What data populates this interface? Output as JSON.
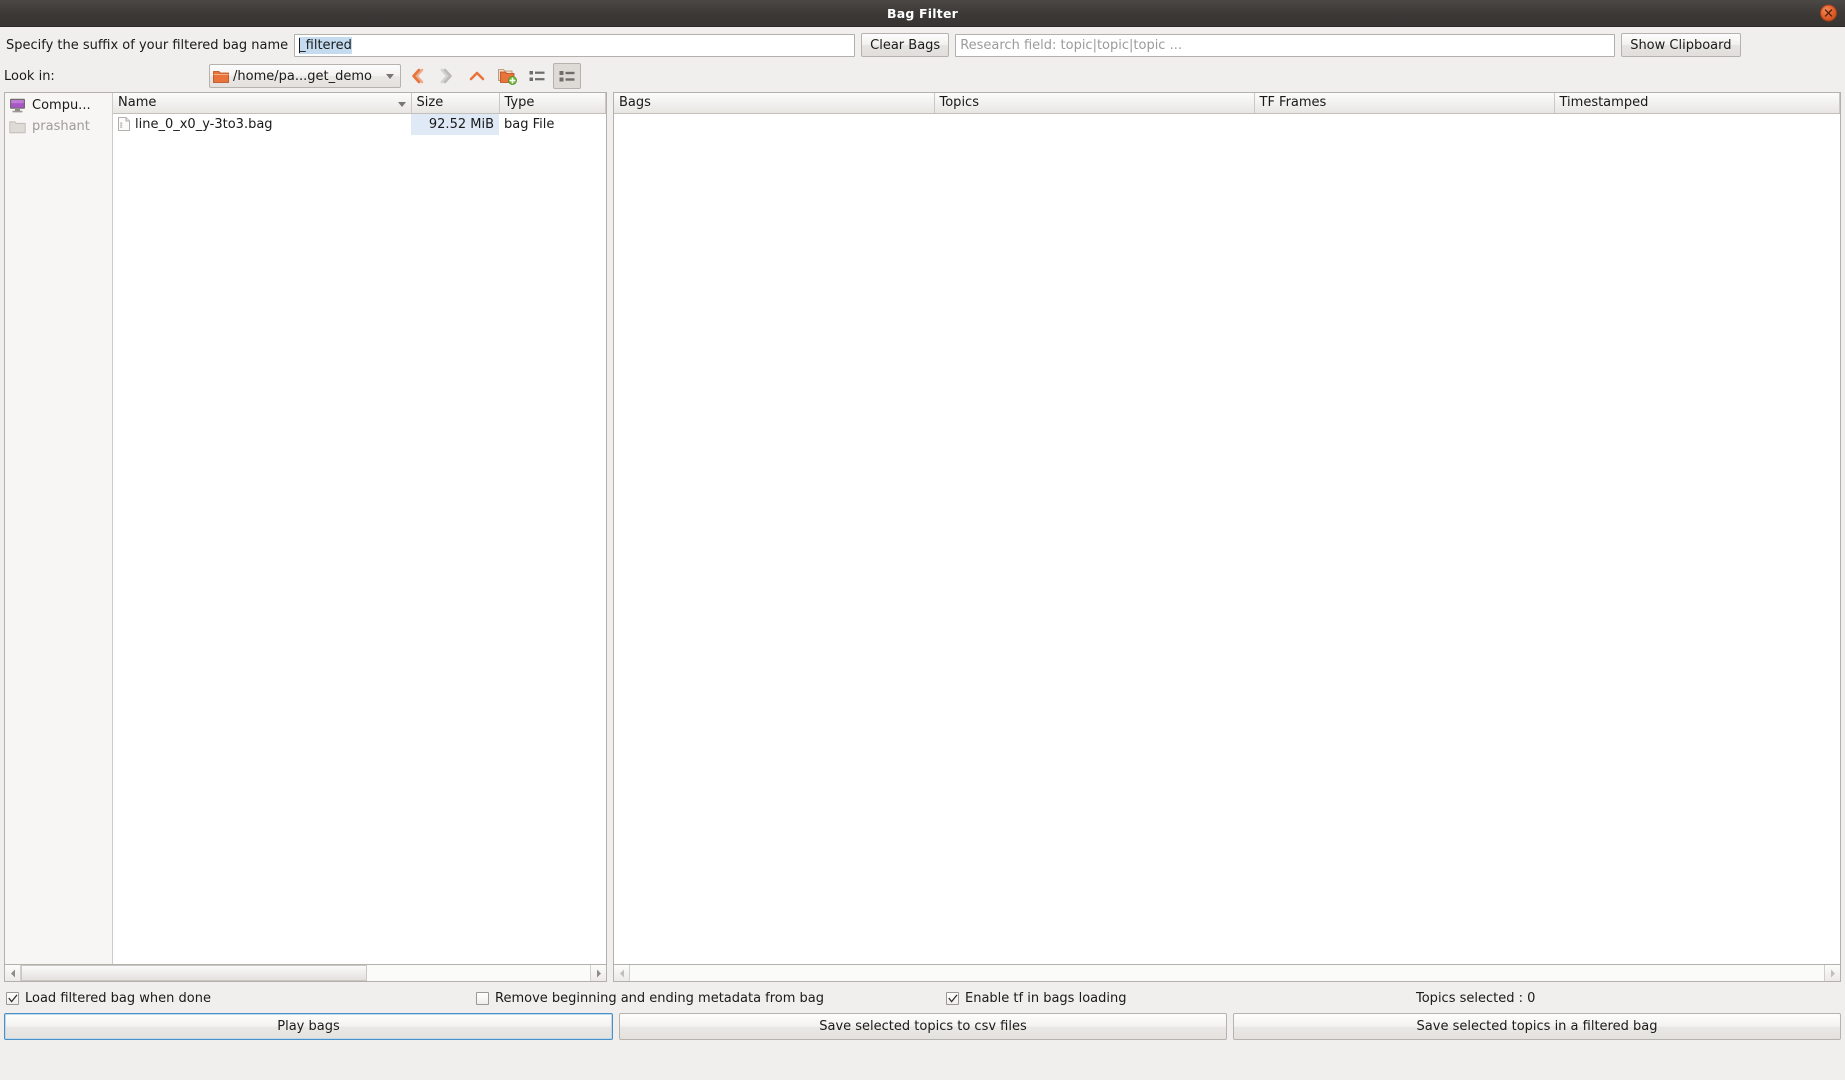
{
  "window": {
    "title": "Bag Filter",
    "close_icon": "close-icon"
  },
  "toolbar": {
    "suffix_label": "Specify the suffix of your filtered bag name",
    "suffix_value": "_filtered",
    "clear_bags_label": "Clear Bags",
    "research_placeholder": "Research field: topic|topic|topic ...",
    "show_clipboard_label": "Show Clipboard"
  },
  "filebrowser": {
    "lookin_label": "Look in:",
    "current_path": "/home/pa...get_demo",
    "icons": {
      "back": "back-arrow-icon",
      "forward": "forward-arrow-icon",
      "parent": "parent-directory-icon",
      "new_folder": "new-folder-icon",
      "list_view": "list-view-icon",
      "detail_view": "detail-view-icon"
    },
    "sidebar": [
      {
        "label": "Compu...",
        "icon": "computer-icon",
        "enabled": true
      },
      {
        "label": "prashant",
        "icon": "folder-icon",
        "enabled": false
      }
    ],
    "columns": [
      "Name",
      "Size",
      "Type"
    ],
    "rows": [
      {
        "name": "line_0_x0_y-3to3.bag",
        "size": "92.52 MiB",
        "type": "bag File"
      }
    ]
  },
  "bagspanel": {
    "columns": [
      "Bags",
      "Topics",
      "TF Frames",
      "Timestamped"
    ],
    "rows": []
  },
  "options": {
    "load_filtered": {
      "label": "Load filtered bag when done",
      "checked": true
    },
    "remove_metadata": {
      "label": "Remove beginning and ending metadata from bag",
      "checked": false
    },
    "enable_tf": {
      "label": "Enable tf in bags loading",
      "checked": true
    },
    "topics_selected": "Topics selected : 0"
  },
  "actions": {
    "play_bags": "Play bags",
    "save_csv": "Save selected topics to csv files",
    "save_filtered": "Save selected topics in a filtered bag"
  },
  "colors": {
    "titlebar": "#3c3937",
    "close_button": "#e2642f",
    "selection": "#dfeaf6",
    "accent_orange": "#e8743b",
    "focus_blue": "#4a90c4"
  }
}
